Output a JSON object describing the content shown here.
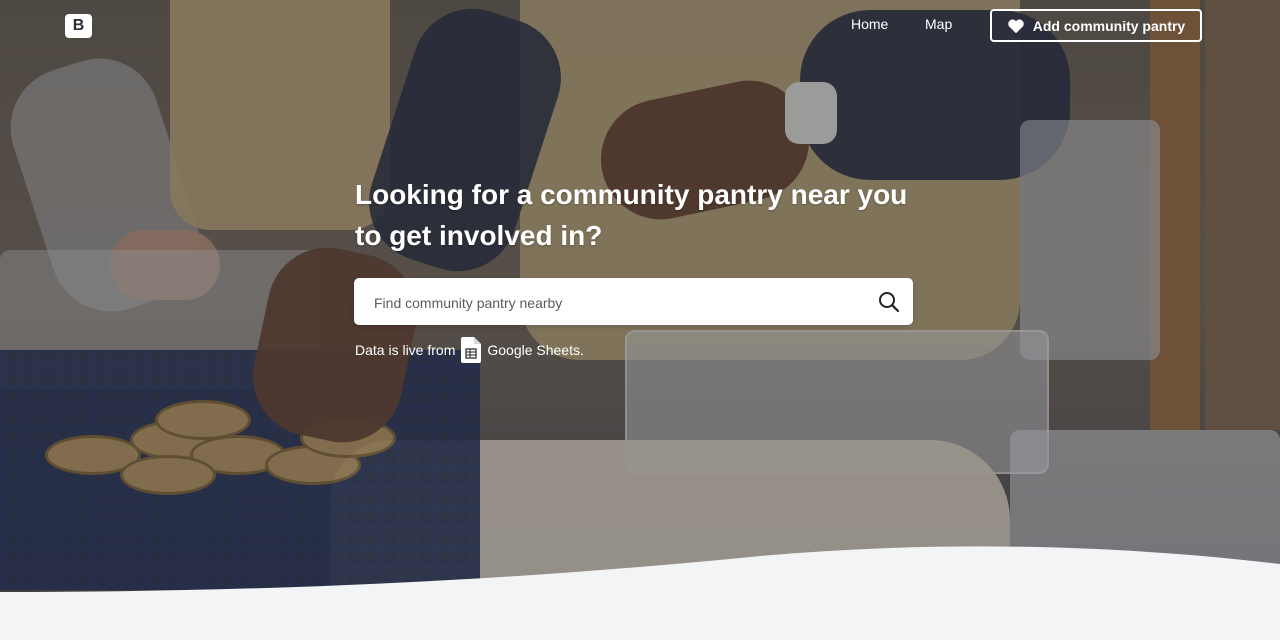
{
  "brand": {
    "logo_letter": "B"
  },
  "nav": {
    "home": "Home",
    "map": "Map",
    "add_button": "Add community pantry"
  },
  "hero": {
    "headline": "Looking for a community pantry near you to get involved in?",
    "search": {
      "placeholder": "Find community pantry nearby",
      "value": ""
    },
    "source_prefix": "Data is live from",
    "source_name": "Google Sheets."
  },
  "colors": {
    "page_background": "#f3f4f6",
    "text_on_hero": "#ffffff",
    "search_background": "#ffffff"
  },
  "icons": [
    "heart-icon",
    "search-icon",
    "google-sheets-icon"
  ]
}
